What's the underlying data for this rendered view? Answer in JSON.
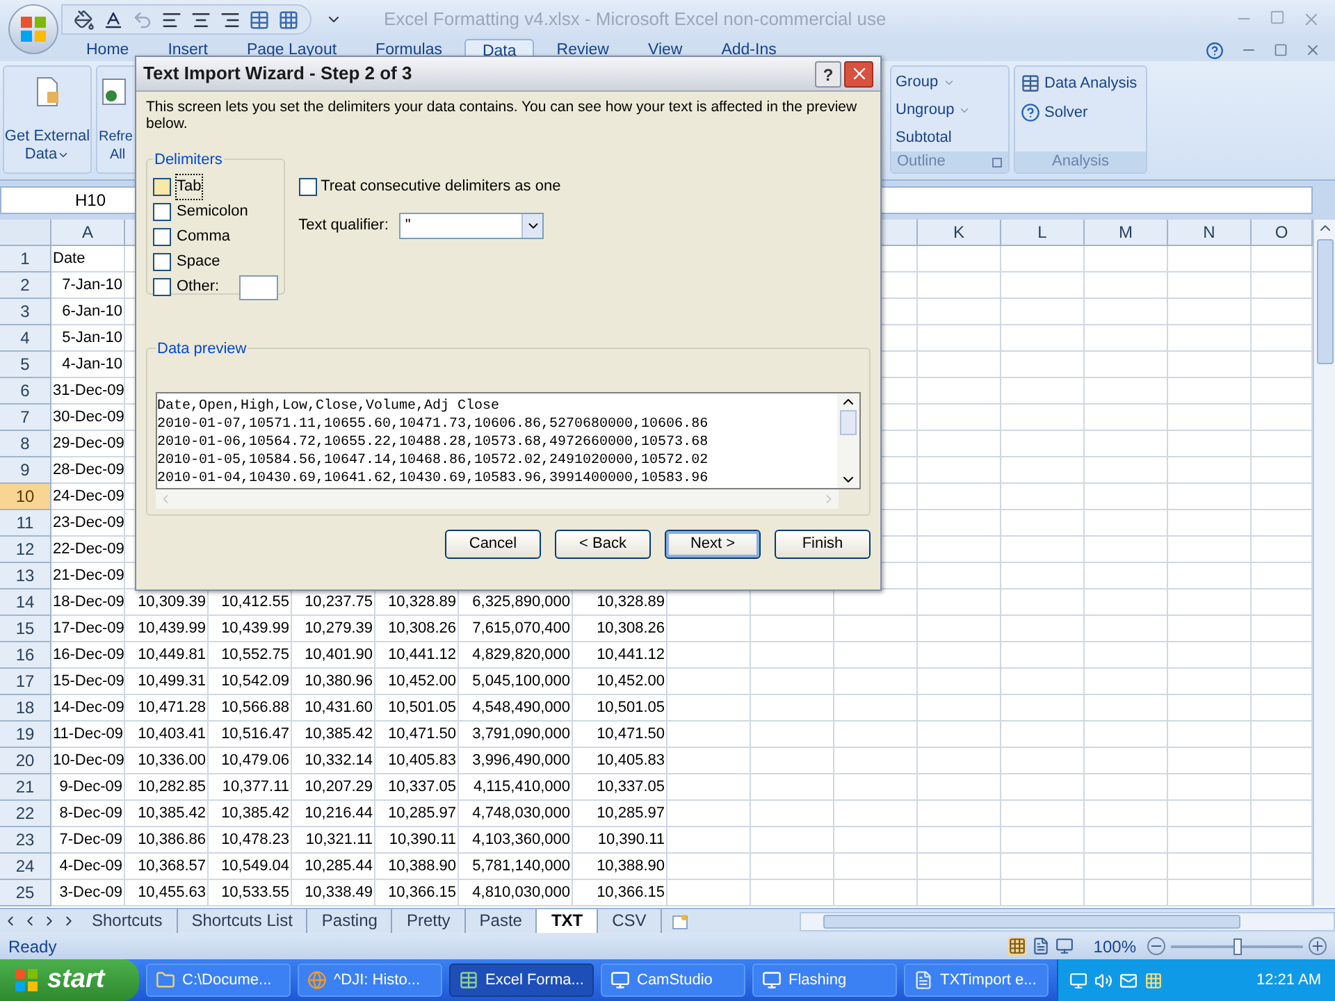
{
  "window": {
    "title": "Excel Formatting v4.xlsx - Microsoft Excel non-commercial use"
  },
  "ribbon_tabs": [
    {
      "label": "Home",
      "selected": false
    },
    {
      "label": "Insert",
      "selected": false
    },
    {
      "label": "Page Layout",
      "selected": false
    },
    {
      "label": "Formulas",
      "selected": false
    },
    {
      "label": "Data",
      "selected": true
    },
    {
      "label": "Review",
      "selected": false
    },
    {
      "label": "View",
      "selected": false
    },
    {
      "label": "Add-Ins",
      "selected": false
    }
  ],
  "ribbon": {
    "get_external_data": {
      "lines": [
        "Get External",
        "Data"
      ]
    },
    "refresh_all": {
      "lines": [
        "Refre",
        "All"
      ]
    },
    "outline": {
      "label": "Outline",
      "items": [
        {
          "label": "Group",
          "dropdown": true
        },
        {
          "label": "Ungroup",
          "dropdown": true
        },
        {
          "label": "Subtotal",
          "dropdown": false
        }
      ]
    },
    "analysis": {
      "label": "Analysis",
      "items": [
        {
          "label": "Data Analysis",
          "kind": "table"
        },
        {
          "label": "Solver",
          "kind": "solver"
        }
      ]
    }
  },
  "formula_bar": {
    "name_box": "H10"
  },
  "sheet": {
    "column_headers": [
      "A",
      "K",
      "L",
      "M",
      "N",
      "O"
    ],
    "rows": [
      {
        "number": "1",
        "selected": false,
        "kind": "header",
        "cells": [
          "Date"
        ]
      },
      {
        "number": "2",
        "selected": false,
        "kind": "data",
        "cells": [
          "7-Jan-10"
        ]
      },
      {
        "number": "3",
        "selected": false,
        "kind": "data",
        "cells": [
          "6-Jan-10"
        ]
      },
      {
        "number": "4",
        "selected": false,
        "kind": "data",
        "cells": [
          "5-Jan-10"
        ]
      },
      {
        "number": "5",
        "selected": false,
        "kind": "data",
        "cells": [
          "4-Jan-10"
        ]
      },
      {
        "number": "6",
        "selected": false,
        "kind": "data",
        "cells": [
          "31-Dec-09"
        ]
      },
      {
        "number": "7",
        "selected": false,
        "kind": "data",
        "cells": [
          "30-Dec-09"
        ]
      },
      {
        "number": "8",
        "selected": false,
        "kind": "data",
        "cells": [
          "29-Dec-09"
        ]
      },
      {
        "number": "9",
        "selected": false,
        "kind": "data",
        "cells": [
          "28-Dec-09"
        ]
      },
      {
        "number": "10",
        "selected": true,
        "kind": "data",
        "cells": [
          "24-Dec-09"
        ]
      },
      {
        "number": "11",
        "selected": false,
        "kind": "data",
        "cells": [
          "23-Dec-09"
        ]
      },
      {
        "number": "12",
        "selected": false,
        "kind": "data",
        "cells": [
          "22-Dec-09"
        ]
      },
      {
        "number": "13",
        "selected": false,
        "kind": "data",
        "cells": [
          "21-Dec-09"
        ]
      },
      {
        "number": "14",
        "selected": false,
        "kind": "data",
        "cells": [
          "18-Dec-09",
          "10,309.39",
          "10,412.55",
          "10,237.75",
          "10,328.89",
          "6,325,890,000",
          "10,328.89"
        ]
      },
      {
        "number": "15",
        "selected": false,
        "kind": "data",
        "cells": [
          "17-Dec-09",
          "10,439.99",
          "10,439.99",
          "10,279.39",
          "10,308.26",
          "7,615,070,400",
          "10,308.26"
        ]
      },
      {
        "number": "16",
        "selected": false,
        "kind": "data",
        "cells": [
          "16-Dec-09",
          "10,449.81",
          "10,552.75",
          "10,401.90",
          "10,441.12",
          "4,829,820,000",
          "10,441.12"
        ]
      },
      {
        "number": "17",
        "selected": false,
        "kind": "data",
        "cells": [
          "15-Dec-09",
          "10,499.31",
          "10,542.09",
          "10,380.96",
          "10,452.00",
          "5,045,100,000",
          "10,452.00"
        ]
      },
      {
        "number": "18",
        "selected": false,
        "kind": "data",
        "cells": [
          "14-Dec-09",
          "10,471.28",
          "10,566.88",
          "10,431.60",
          "10,501.05",
          "4,548,490,000",
          "10,501.05"
        ]
      },
      {
        "number": "19",
        "selected": false,
        "kind": "data",
        "cells": [
          "11-Dec-09",
          "10,403.41",
          "10,516.47",
          "10,385.42",
          "10,471.50",
          "3,791,090,000",
          "10,471.50"
        ]
      },
      {
        "number": "20",
        "selected": false,
        "kind": "data",
        "cells": [
          "10-Dec-09",
          "10,336.00",
          "10,479.06",
          "10,332.14",
          "10,405.83",
          "3,996,490,000",
          "10,405.83"
        ]
      },
      {
        "number": "21",
        "selected": false,
        "kind": "data",
        "cells": [
          "9-Dec-09",
          "10,282.85",
          "10,377.11",
          "10,207.29",
          "10,337.05",
          "4,115,410,000",
          "10,337.05"
        ]
      },
      {
        "number": "22",
        "selected": false,
        "kind": "data",
        "cells": [
          "8-Dec-09",
          "10,385.42",
          "10,385.42",
          "10,216.44",
          "10,285.97",
          "4,748,030,000",
          "10,285.97"
        ]
      },
      {
        "number": "23",
        "selected": false,
        "kind": "data",
        "cells": [
          "7-Dec-09",
          "10,386.86",
          "10,478.23",
          "10,321.11",
          "10,390.11",
          "4,103,360,000",
          "10,390.11"
        ]
      },
      {
        "number": "24",
        "selected": false,
        "kind": "data",
        "cells": [
          "4-Dec-09",
          "10,368.57",
          "10,549.04",
          "10,285.44",
          "10,388.90",
          "5,781,140,000",
          "10,388.90"
        ]
      },
      {
        "number": "25",
        "selected": false,
        "kind": "data",
        "cells": [
          "3-Dec-09",
          "10,455.63",
          "10,533.55",
          "10,338.49",
          "10,366.15",
          "4,810,030,000",
          "10,366.15"
        ]
      }
    ]
  },
  "dialog": {
    "title": "Text Import Wizard - Step 2 of 3",
    "help": "?",
    "description": "This screen lets you set the delimiters your data contains.  You can see how your text is affected in the preview below.",
    "delimiters": {
      "label": "Delimiters",
      "options": [
        {
          "label": "Tab",
          "checked": false,
          "focused": true,
          "kind": "plain"
        },
        {
          "label": "Semicolon",
          "checked": false,
          "focused": false,
          "kind": "plain"
        },
        {
          "label": "Comma",
          "checked": false,
          "focused": false,
          "kind": "plain"
        },
        {
          "label": "Space",
          "checked": false,
          "focused": false,
          "kind": "plain"
        },
        {
          "label": "Other:",
          "checked": false,
          "focused": false,
          "kind": "with_field"
        }
      ]
    },
    "consecutive": {
      "label": "Treat consecutive delimiters as one",
      "checked": false
    },
    "qualifier": {
      "label": "Text qualifier:",
      "value": "\""
    },
    "preview": {
      "label": "Data preview",
      "lines": [
        "Date,Open,High,Low,Close,Volume,Adj Close",
        "2010-01-07,10571.11,10655.60,10471.73,10606.86,5270680000,10606.86",
        "2010-01-06,10564.72,10655.22,10488.28,10573.68,4972660000,10573.68",
        "2010-01-05,10584.56,10647.14,10468.86,10572.02,2491020000,10572.02",
        "2010-01-04,10430.69,10641.62,10430.69,10583.96,3991400000,10583.96"
      ]
    },
    "buttons": [
      {
        "label": "Cancel",
        "default": false
      },
      {
        "label": "< Back",
        "default": false
      },
      {
        "label": "Next >",
        "default": true
      },
      {
        "label": "Finish",
        "default": false
      }
    ]
  },
  "sheet_tabs": [
    {
      "label": "Shortcuts",
      "selected": false
    },
    {
      "label": "Shortcuts List",
      "selected": false
    },
    {
      "label": "Pasting",
      "selected": false
    },
    {
      "label": "Pretty",
      "selected": false
    },
    {
      "label": "Paste",
      "selected": false
    },
    {
      "label": "TXT",
      "selected": true
    },
    {
      "label": "CSV",
      "selected": false
    }
  ],
  "status_bar": {
    "status": "Ready",
    "zoom": "100%",
    "zoom_slider": {
      "level": 0.5
    }
  },
  "taskbar": {
    "start": "start",
    "items": [
      {
        "label": "C:\\Docume...",
        "kind": "folder",
        "selected": false
      },
      {
        "label": "^DJI: Histo...",
        "kind": "browser",
        "selected": false
      },
      {
        "label": "Excel Forma...",
        "kind": "excel",
        "selected": true
      },
      {
        "label": "CamStudio",
        "kind": "app",
        "selected": false
      },
      {
        "label": "Flashing",
        "kind": "app",
        "selected": false
      },
      {
        "label": "TXTimport e...",
        "kind": "document",
        "selected": false
      }
    ],
    "clock": "12:21 AM"
  }
}
